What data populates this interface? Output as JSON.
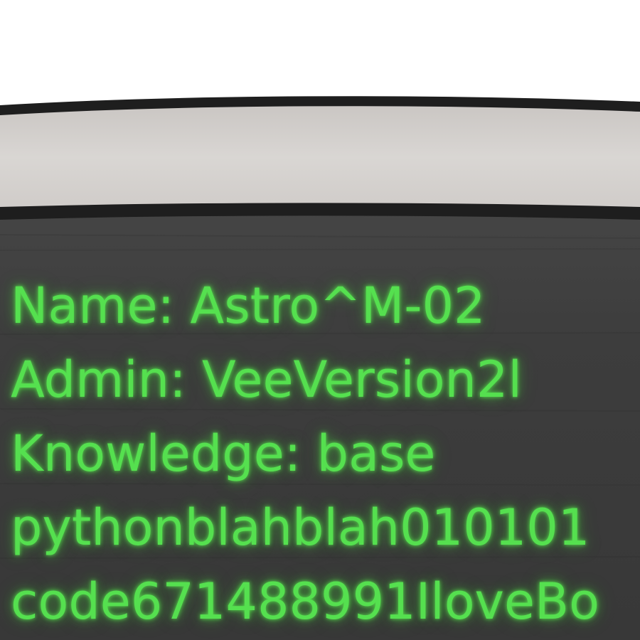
{
  "screen": {
    "lines": [
      "Name: Astro^M-02",
      "Admin: VeeVersion2l",
      "Knowledge: base",
      "pythonblahblah010101",
      "code671488991IloveBo"
    ]
  },
  "colors": {
    "background": "#ffffff",
    "bezel": "#1e1e1e",
    "top_panel": "#d9d6d3",
    "screen": "#3c3c3c",
    "text_glow": "#55e04f"
  }
}
